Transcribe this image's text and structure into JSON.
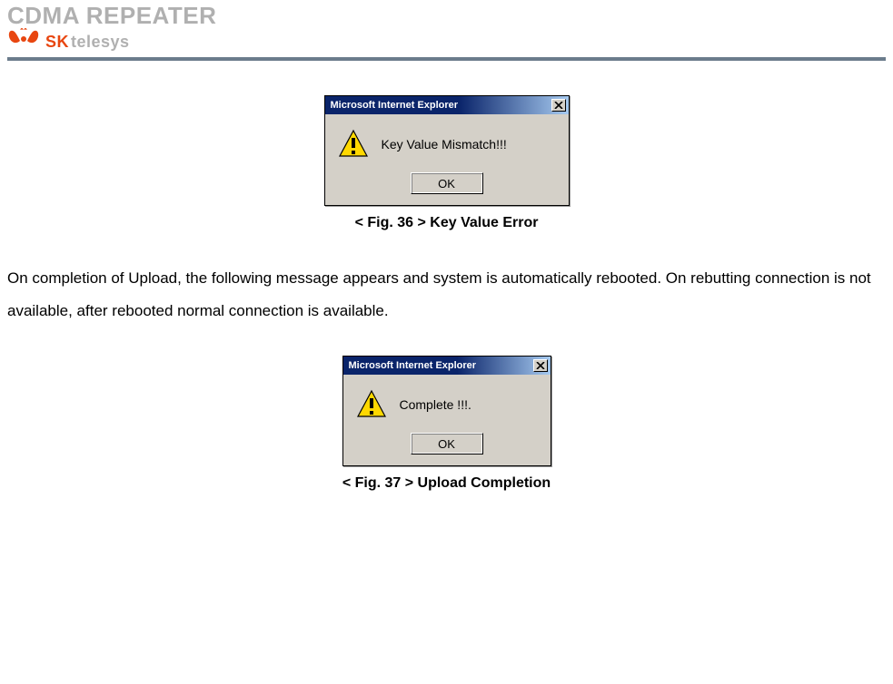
{
  "header": {
    "title": "CDMA REPEATER",
    "brand": "SK",
    "brand_suffix": "telesys"
  },
  "fig1": {
    "titlebar": "Microsoft Internet Explorer",
    "message": "Key Value Mismatch!!!",
    "ok_label": "OK",
    "caption": "< Fig. 36 > Key Value Error"
  },
  "paragraph": "On completion of Upload, the following message appears and system is automatically rebooted. On rebutting connection is not available, after rebooted normal connection is available.",
  "fig2": {
    "titlebar": "Microsoft Internet Explorer",
    "message": "Complete !!!.",
    "ok_label": "OK",
    "caption": "< Fig. 37 > Upload Completion"
  }
}
